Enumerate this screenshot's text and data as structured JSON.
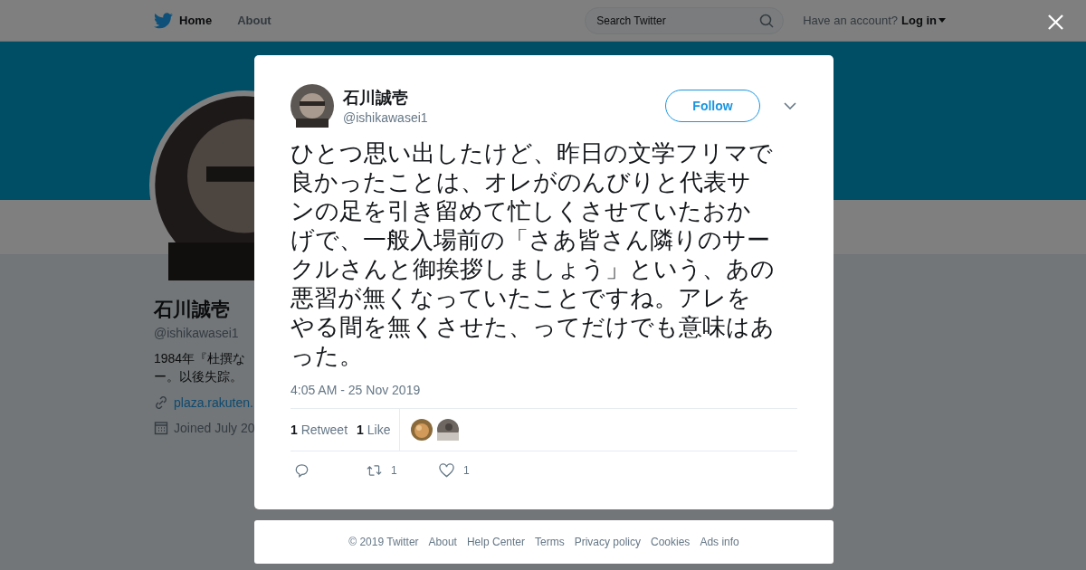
{
  "topbar": {
    "nav": [
      {
        "label": "Home",
        "selected": true
      },
      {
        "label": "About",
        "selected": false
      }
    ],
    "search": {
      "placeholder": "Search Twitter"
    },
    "account_prompt": "Have an account?",
    "login": "Log in"
  },
  "profile": {
    "name": "石川誠壱",
    "handle": "@ishikawasei1",
    "bio": [
      "1984年『杜撰な",
      "ー。以後失踪。"
    ],
    "link": "plaza.rakuten.",
    "joined": "Joined July 20"
  },
  "tweet": {
    "author": {
      "name": "石川誠壱",
      "handle": "@ishikawasei1"
    },
    "follow": "Follow",
    "text": "ひとつ思い出したけど、昨日の文学フリマで良かったことは、オレがのんびりと代表サンの足を引き留めて忙しくさせていたおかげで、一般入場前の「さあ皆さん隣りのサークルさんと御挨拶しましょう」という、あの悪習が無くなっていたことですね。アレをやる間を無くさせた、ってだけでも意味はあった。",
    "time": "4:05 AM - 25 Nov 2019",
    "stats": [
      {
        "count": "1",
        "label": "Retweet"
      },
      {
        "count": "1",
        "label": "Like"
      }
    ],
    "actions": [
      {
        "kind": "reply"
      },
      {
        "kind": "retweet",
        "count": "1"
      },
      {
        "kind": "like",
        "count": "1"
      }
    ]
  },
  "footer": [
    "© 2019 Twitter",
    "About",
    "Help Center",
    "Terms",
    "Privacy policy",
    "Cookies",
    "Ads info"
  ]
}
